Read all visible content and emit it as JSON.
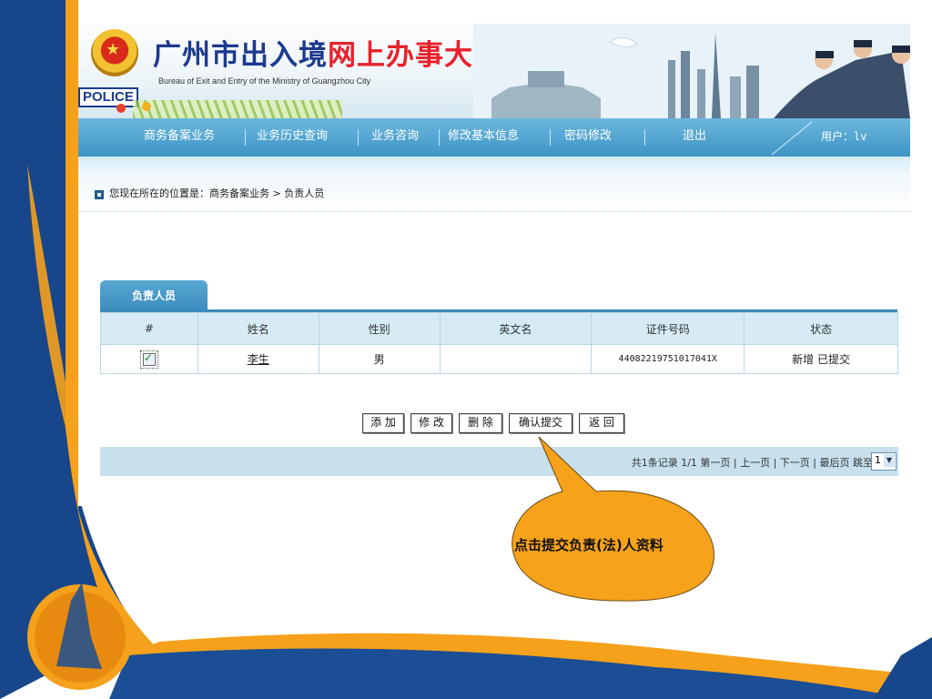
{
  "header": {
    "title_part1": "广州市出入境",
    "title_part2": "网上办事大厅",
    "subtitle": "Bureau of Exit and Entry of the Ministry of Guangzhou City",
    "badge": "POLICE"
  },
  "nav": {
    "items": [
      "商务备案业务",
      "业务历史查询",
      "业务咨询",
      "修改基本信息",
      "密码修改",
      "退出"
    ],
    "user_label": "用户：",
    "user_value": "lv"
  },
  "breadcrumb": {
    "text": "您现在所在的位置是：商务备案业务 > 负责人员"
  },
  "tab": {
    "label": "负责人员"
  },
  "table": {
    "columns": [
      "#",
      "姓名",
      "性别",
      "英文名",
      "证件号码",
      "状态"
    ],
    "rows": [
      {
        "checked": true,
        "name": "李生",
        "gender": "男",
        "english_name": "",
        "id_number": "44082219751017041X",
        "status": "新增 已提交"
      }
    ]
  },
  "actions": {
    "add": "添 加",
    "edit": "修 改",
    "delete": "删 除",
    "confirm": "确认提交",
    "back": "返 回"
  },
  "pager": {
    "text": "共1条记录  1/1  第一页 | 上一页 | 下一页 | 最后页  跳至",
    "page_select_value": "1"
  },
  "callout": {
    "text": "点击提交负责(法)人资料"
  },
  "colors": {
    "nav_bg": "#3d95c6",
    "accent_orange": "#f7a21b",
    "dark_blue": "#1a4a8a",
    "title_blue": "#1b3a8f",
    "title_red": "#e8212b",
    "callout_fill": "#f7a21b"
  }
}
